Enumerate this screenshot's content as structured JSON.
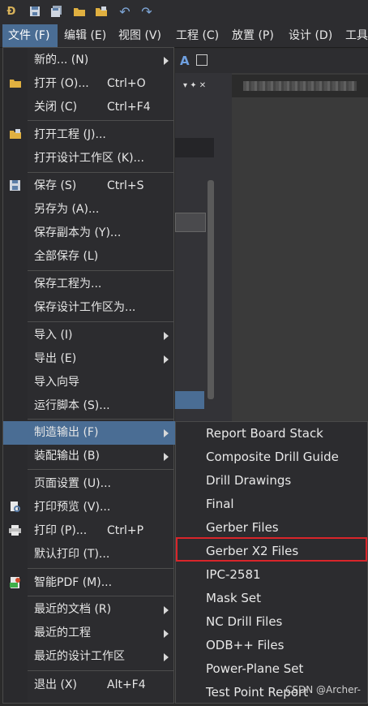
{
  "toolbar": {
    "icons": [
      "app-logo-icon",
      "save-icon",
      "save-all-icon",
      "open-folder-icon",
      "open-project-icon",
      "undo-icon",
      "redo-icon"
    ]
  },
  "menubar": {
    "items": [
      "文件 (F)",
      "编辑 (E)",
      "视图 (V)",
      "工程 (C)",
      "放置 (P)",
      "设计 (D)",
      "工具"
    ]
  },
  "file_menu": {
    "items": [
      {
        "label": "新的... (N)",
        "shortcut": "",
        "submenu": true
      },
      {
        "label": "打开 (O)...",
        "shortcut": "Ctrl+O",
        "submenu": false
      },
      {
        "label": "关闭 (C)",
        "shortcut": "Ctrl+F4",
        "submenu": false
      },
      {
        "label": "打开工程 (J)...",
        "shortcut": "",
        "submenu": false
      },
      {
        "label": "打开设计工作区 (K)...",
        "shortcut": "",
        "submenu": false
      },
      {
        "label": "保存 (S)",
        "shortcut": "Ctrl+S",
        "submenu": false
      },
      {
        "label": "另存为 (A)...",
        "shortcut": "",
        "submenu": false
      },
      {
        "label": "保存副本为 (Y)...",
        "shortcut": "",
        "submenu": false
      },
      {
        "label": "全部保存 (L)",
        "shortcut": "",
        "submenu": false
      },
      {
        "label": "保存工程为...",
        "shortcut": "",
        "submenu": false
      },
      {
        "label": "保存设计工作区为...",
        "shortcut": "",
        "submenu": false
      },
      {
        "label": "导入 (I)",
        "shortcut": "",
        "submenu": true
      },
      {
        "label": "导出 (E)",
        "shortcut": "",
        "submenu": true
      },
      {
        "label": "导入向导",
        "shortcut": "",
        "submenu": false
      },
      {
        "label": "运行脚本 (S)...",
        "shortcut": "",
        "submenu": false
      },
      {
        "label": "制造输出 (F)",
        "shortcut": "",
        "submenu": true
      },
      {
        "label": "装配输出 (B)",
        "shortcut": "",
        "submenu": true
      },
      {
        "label": "页面设置 (U)...",
        "shortcut": "",
        "submenu": false
      },
      {
        "label": "打印预览 (V)...",
        "shortcut": "",
        "submenu": false
      },
      {
        "label": "打印 (P)...",
        "shortcut": "Ctrl+P",
        "submenu": false
      },
      {
        "label": "默认打印 (T)...",
        "shortcut": "",
        "submenu": false
      },
      {
        "label": "智能PDF (M)...",
        "shortcut": "",
        "submenu": false
      },
      {
        "label": "最近的文档 (R)",
        "shortcut": "",
        "submenu": true
      },
      {
        "label": "最近的工程",
        "shortcut": "",
        "submenu": true
      },
      {
        "label": "最近的设计工作区",
        "shortcut": "",
        "submenu": true
      },
      {
        "label": "退出 (X)",
        "shortcut": "Alt+F4",
        "submenu": false
      }
    ]
  },
  "fab_submenu": {
    "items": [
      "Report Board Stack",
      "Composite Drill Guide",
      "Drill Drawings",
      "Final",
      "Gerber Files",
      "Gerber X2 Files",
      "IPC-2581",
      "Mask Set",
      "NC Drill Files",
      "ODB++ Files",
      "Power-Plane Set",
      "Test Point Report"
    ],
    "highlighted": "Gerber X2 Files"
  },
  "background": {
    "tab_label": "Track"
  },
  "watermark": "CSDN @Archer-",
  "colors": {
    "accent": "#4a6d94",
    "highlight_box": "#d9252a",
    "menu_bg": "#2c2c2f"
  }
}
